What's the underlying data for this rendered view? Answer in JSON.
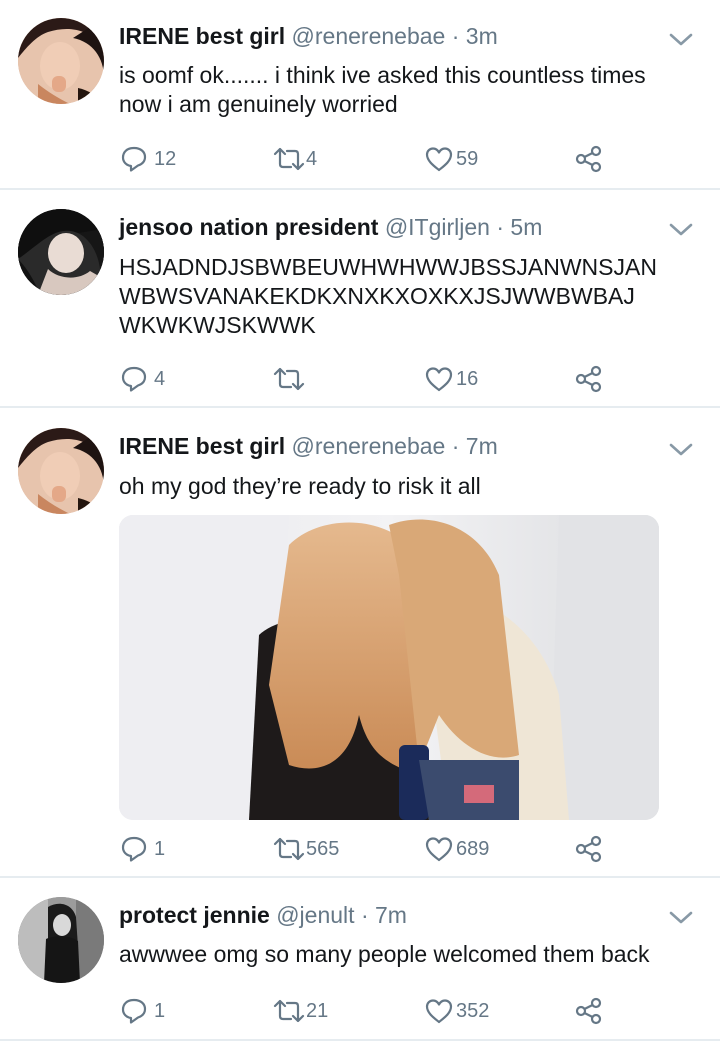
{
  "tweets": [
    {
      "name": "IRENE best girl",
      "handle": "@renerenebae",
      "dot": "·",
      "time": "3m",
      "lines": [
        "is oomf ok....... i think ive asked this countless times",
        "now i am genuinely worried"
      ],
      "replies": "12",
      "retweets": "4",
      "likes": "59"
    },
    {
      "name": "jensoo nation president",
      "handle": "@ITgirljen",
      "dot": "·",
      "time": "5m",
      "lines": [
        "HSJADNDJSBWBEUWHWHWWJBSSJANWNSJAN",
        "WBWSVANAKEKDKXNXKXOXKXJSJWWBWBAJ",
        "WKWKWJSKWWK"
      ],
      "replies": "4",
      "retweets": "",
      "likes": "16"
    },
    {
      "name": "IRENE best girl",
      "handle": "@renerenebae",
      "dot": "·",
      "time": "7m",
      "lines": [
        "oh my god they’re ready to risk it all"
      ],
      "replies": "1",
      "retweets": "565",
      "likes": "689"
    },
    {
      "name": "protect jennie",
      "handle": "@jenult",
      "dot": "·",
      "time": "7m",
      "lines": [
        "awwwee omg so many people welcomed them back"
      ],
      "replies": "1",
      "retweets": "21",
      "likes": "352"
    }
  ],
  "colors": {
    "text": "#14171a",
    "muted": "#657786",
    "divider": "#e6ecf0"
  },
  "icons": [
    "reply-icon",
    "retweet-icon",
    "like-icon",
    "share-icon",
    "chevron-down-icon"
  ]
}
